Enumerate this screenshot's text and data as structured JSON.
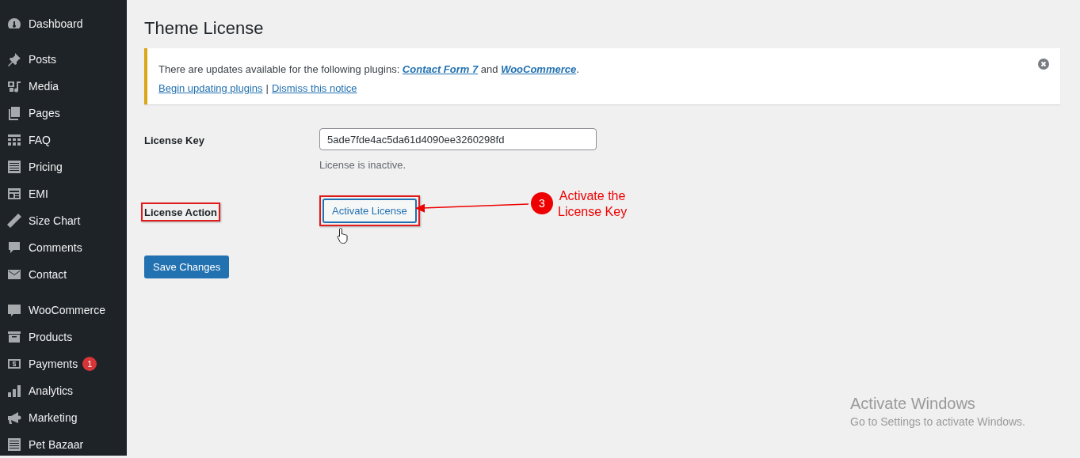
{
  "sidebar": {
    "groups": [
      [
        {
          "label": "Dashboard"
        }
      ],
      [
        {
          "label": "Posts"
        },
        {
          "label": "Media"
        },
        {
          "label": "Pages"
        },
        {
          "label": "FAQ"
        },
        {
          "label": "Pricing"
        },
        {
          "label": "EMI"
        },
        {
          "label": "Size Chart"
        },
        {
          "label": "Comments"
        },
        {
          "label": "Contact"
        }
      ],
      [
        {
          "label": "WooCommerce"
        },
        {
          "label": "Products"
        },
        {
          "label": "Payments",
          "badge": "1"
        },
        {
          "label": "Analytics"
        },
        {
          "label": "Marketing"
        },
        {
          "label": "Pet Bazaar"
        }
      ]
    ]
  },
  "page": {
    "title": "Theme License"
  },
  "notice": {
    "message": [
      {
        "kind": "text",
        "text": "There are updates available for the following plugins: "
      },
      {
        "kind": "link",
        "text": "Contact Form 7"
      },
      {
        "kind": "text",
        "text": " and "
      },
      {
        "kind": "link",
        "text": "WooCommerce"
      },
      {
        "kind": "text",
        "text": "."
      }
    ],
    "actions": [
      {
        "kind": "link",
        "text": "Begin updating plugins"
      },
      {
        "kind": "separator",
        "text": "|"
      },
      {
        "kind": "link",
        "text": "Dismiss this notice"
      }
    ]
  },
  "form": {
    "license_key": {
      "label": "License Key",
      "value": "5ade7fde4ac5da61d4090ee3260298fd",
      "help": "License is inactive."
    },
    "license_action": {
      "label": "License Action",
      "button": "Activate License"
    },
    "save_button": "Save Changes"
  },
  "annotation": {
    "step": "3",
    "lines": [
      "Activate the",
      "License Key"
    ]
  },
  "os_notice": {
    "title": "Activate Windows",
    "text": "Go to Settings to activate Windows."
  }
}
